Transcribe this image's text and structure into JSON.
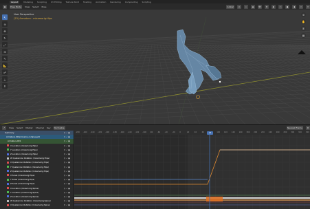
{
  "topbar": {
    "workspaces": [
      "Layout",
      "Modeling",
      "Sculpting",
      "UV Editing",
      "Texture Paint",
      "Shading",
      "Animation",
      "Rendering",
      "Compositing",
      "Scripting"
    ]
  },
  "viewport": {
    "mode": "Pose Mode",
    "menus": [
      "View",
      "Select",
      "Pose"
    ],
    "overlay_line1": "User Perspective",
    "overlay_line2": "(23) Armature : mixamorig:Hips",
    "transform_orientation": "Global"
  },
  "graph_editor": {
    "menus": [
      "View",
      "Select",
      "Marker",
      "Channel",
      "Key"
    ],
    "mode": "Normalize",
    "filter_label": "Nearest Frame",
    "current_frame": "23",
    "ruler_ticks": [
      "-280",
      "-260",
      "-240",
      "-220",
      "-200",
      "-180",
      "-160",
      "-140",
      "-120",
      "-100",
      "-80",
      "-60",
      "-40",
      "-20",
      "0",
      "20",
      "40",
      "60",
      "80",
      "100",
      "120",
      "140",
      "160",
      "180",
      "200",
      "220",
      "240",
      "260",
      "280",
      "300",
      "320",
      "340"
    ],
    "channels": [
      {
        "label": "Summary",
        "type": "summary",
        "color": "#3a4e66"
      },
      {
        "label": "Armature.001|mixamo.com|Layer0",
        "type": "object",
        "color": "#2c5a7a"
      },
      {
        "label": "Armature.001",
        "type": "action",
        "color": "#355434"
      },
      {
        "label": "X Location (mixamorig:Hips)",
        "type": "fcurve",
        "color": "#e05050"
      },
      {
        "label": "Y Location (mixamorig:Hips)",
        "type": "fcurve",
        "color": "#50c050"
      },
      {
        "label": "Z Location (mixamorig:Hips)",
        "type": "fcurve",
        "color": "#5070e0"
      },
      {
        "label": "W Quaternion Rotation (mixamorig:Hips)",
        "type": "fcurve",
        "color": "#c0c0c0"
      },
      {
        "label": "X Quaternion Rotation (mixamorig:Hips)",
        "type": "fcurve",
        "color": "#e05050"
      },
      {
        "label": "Y Quaternion Rotation (mixamorig:Hips)",
        "type": "fcurve",
        "color": "#50c050"
      },
      {
        "label": "Z Quaternion Rotation (mixamorig:Hips)",
        "type": "fcurve",
        "color": "#5070e0"
      },
      {
        "label": "X Scale (mixamorig:Hips)",
        "type": "fcurve",
        "color": "#e05050"
      },
      {
        "label": "Y Scale (mixamorig:Hips)",
        "type": "fcurve",
        "color": "#50c050"
      },
      {
        "label": "Z Scale (mixamorig:Hips)",
        "type": "fcurve",
        "color": "#5070e0"
      },
      {
        "label": "X Location (mixamorig:Spine)",
        "type": "fcurve",
        "color": "#e05050"
      },
      {
        "label": "Y Location (mixamorig:Spine)",
        "type": "fcurve",
        "color": "#50c050"
      },
      {
        "label": "Z Location (mixamorig:Spine)",
        "type": "fcurve",
        "color": "#5070e0"
      },
      {
        "label": "W Quaternion Rotation (mixamorig:Spine)",
        "type": "fcurve",
        "color": "#c0c0c0"
      },
      {
        "label": "X Quaternion Rotation (mixamorig:Spine)",
        "type": "fcurve",
        "color": "#e05050"
      }
    ]
  }
}
